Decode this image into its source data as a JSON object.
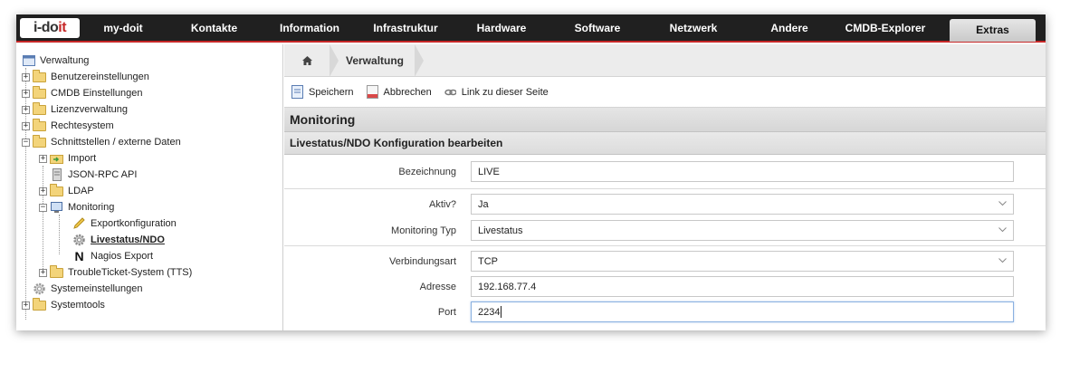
{
  "logo": {
    "prefix": "i-do",
    "accent": "it"
  },
  "nav": [
    {
      "label": "my-doit",
      "w": 96
    },
    {
      "label": "Kontakte",
      "w": 105
    },
    {
      "label": "Information",
      "w": 106
    },
    {
      "label": "Infrastruktur",
      "w": 106
    },
    {
      "label": "Hardware",
      "w": 106
    },
    {
      "label": "Software",
      "w": 106
    },
    {
      "label": "Netzwerk",
      "w": 106
    },
    {
      "label": "Andere",
      "w": 106
    },
    {
      "label": "CMDB-Explorer",
      "w": 106
    }
  ],
  "nav_active": "Extras",
  "tree": {
    "root": "Verwaltung",
    "benutzer": "Benutzereinstellungen",
    "cmdb": "CMDB Einstellungen",
    "lizenz": "Lizenzverwaltung",
    "rechte": "Rechtesystem",
    "schnitt": "Schnittstellen / externe Daten",
    "import": "Import",
    "jsonrpc": "JSON-RPC API",
    "ldap": "LDAP",
    "monitoring": "Monitoring",
    "export": "Exportkonfiguration",
    "livestatus": "Livestatus/NDO",
    "nagios": "Nagios Export",
    "tts": "TroubleTicket-System (TTS)",
    "system": "Systemeinstellungen",
    "tools": "Systemtools"
  },
  "breadcrumb": {
    "current": "Verwaltung"
  },
  "toolbar": {
    "save": "Speichern",
    "cancel": "Abbrechen",
    "link": "Link zu dieser Seite"
  },
  "section_title": "Monitoring",
  "sub_title": "Livestatus/NDO Konfiguration bearbeiten",
  "form": {
    "bezeichnung": {
      "label": "Bezeichnung",
      "value": "LIVE"
    },
    "aktiv": {
      "label": "Aktiv?",
      "value": "Ja"
    },
    "typ": {
      "label": "Monitoring Typ",
      "value": "Livestatus"
    },
    "verbindung": {
      "label": "Verbindungsart",
      "value": "TCP"
    },
    "adresse": {
      "label": "Adresse",
      "value": "192.168.77.4"
    },
    "port": {
      "label": "Port",
      "value": "2234"
    }
  }
}
